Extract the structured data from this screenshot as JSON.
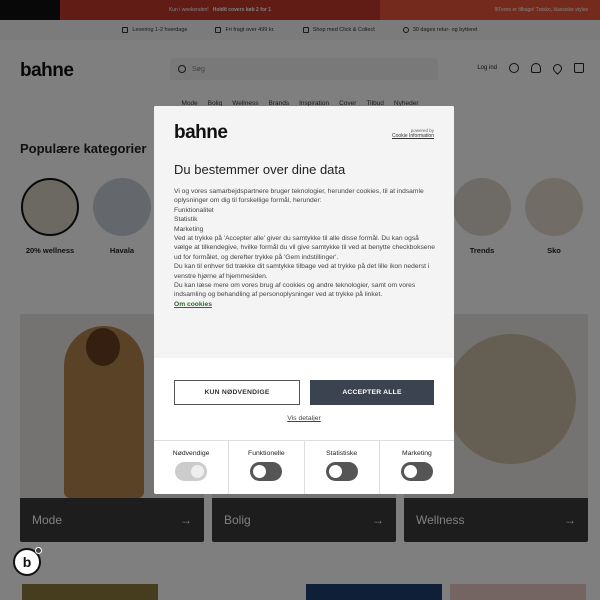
{
  "promo": {
    "left_text": "Kun i weekenden!",
    "middle_text": "Holdit covers køb 2 for 1",
    "right_text": "90'erne er tilbage! Tøisko, klassiske styles"
  },
  "usp": [
    {
      "icon": "truck-icon",
      "label": "Levering 1-2 hverdage"
    },
    {
      "icon": "box-icon",
      "label": "Fri fragt over 499 kr."
    },
    {
      "icon": "store-icon",
      "label": "Shop med Click & Collect"
    },
    {
      "icon": "return-icon",
      "label": "30 dages retur- og bytteret"
    }
  ],
  "header": {
    "logo": "bahne",
    "search_placeholder": "Søg",
    "login_label": "Log ind"
  },
  "nav": [
    "Mode",
    "Bolig",
    "Wellness",
    "Brands",
    "Inspiration",
    "Cover",
    "Tilbud",
    "Nyheder"
  ],
  "categories": {
    "title": "Populære kategorier",
    "items": [
      {
        "label": "20% wellness"
      },
      {
        "label": "Havala"
      },
      {
        "label": ""
      },
      {
        "label": ""
      },
      {
        "label": ""
      },
      {
        "label": ""
      },
      {
        "label": ""
      },
      {
        "label": "Trends"
      },
      {
        "label": "Sko"
      }
    ]
  },
  "tiles": [
    {
      "label": "Mode",
      "arrow": "→"
    },
    {
      "label": "Bolig",
      "arrow": "→"
    },
    {
      "label": "Wellness",
      "arrow": "→"
    }
  ],
  "badge": {
    "letter": "b"
  },
  "modal": {
    "logo": "bahne",
    "powered_by": "powered by",
    "cookiebot": "Cookie Information",
    "title": "Du bestemmer over dine data",
    "body": "Vi og vores samarbejdspartnere bruger teknologier, herunder cookies, til at indsamle oplysninger om dig til forskellige formål, herunder:\nFunktionalitet\nStatistik\nMarketing\nVed at trykke på 'Accepter alle' giver du samtykke til alle disse formål. Du kan også vælge at tilkendegive, hvilke formål du vil give samtykke til ved at benytte checkboksene ud for formålet, og derefter trykke på 'Gem indstillinger'.\nDu kan til enhver tid trække dit samtykke tilbage ved at trykke på det lille ikon nederst i venstre hjørne af hjemmesiden.\nDu kan læse mere om vores brug af cookies og andre teknologier, samt om vores indsamling og behandling af personoplysninger ved at trykke på linket.",
    "link": "Om cookies",
    "btn_necessary": "KUN NØDVENDIGE",
    "btn_accept": "ACCEPTER ALLE",
    "details": "Vis detaljer",
    "toggles": [
      {
        "label": "Nødvendige",
        "on": true,
        "disabled": true
      },
      {
        "label": "Funktionelle",
        "on": false,
        "disabled": false
      },
      {
        "label": "Statistiske",
        "on": false,
        "disabled": false
      },
      {
        "label": "Marketing",
        "on": false,
        "disabled": false
      }
    ]
  }
}
